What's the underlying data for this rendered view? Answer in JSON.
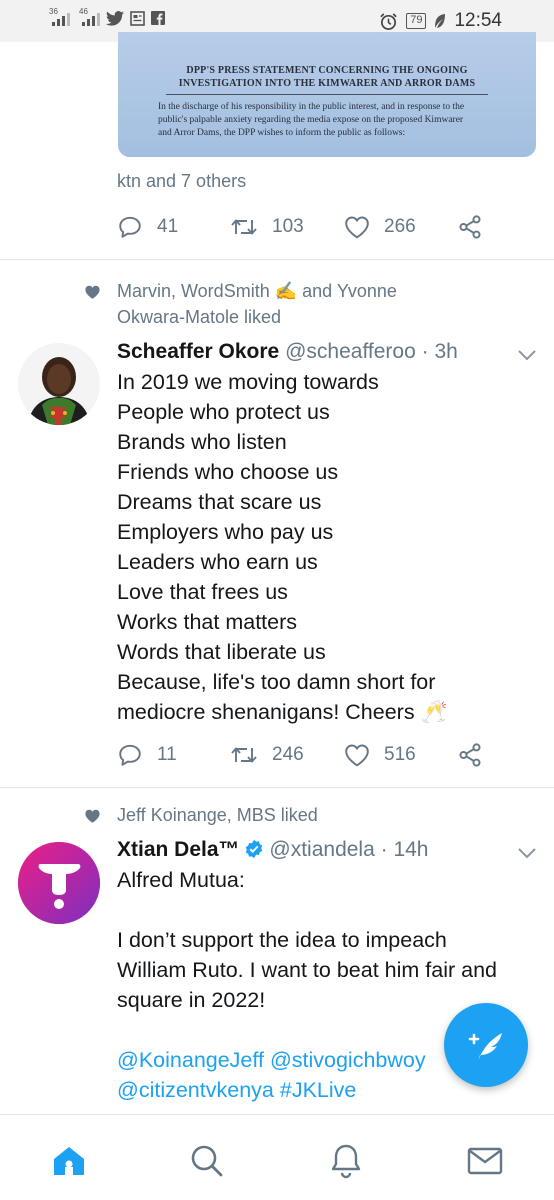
{
  "status_bar": {
    "network_1": "36",
    "network_2": "46",
    "battery": "79",
    "time": "12:54"
  },
  "tweet1": {
    "document": {
      "heading_line1": "DPP'S PRESS STATEMENT CONCERNING THE ONGOING",
      "heading_line2": "INVESTIGATION INTO THE KIMWARER AND ARROR DAMS",
      "body_line1": "In the discharge of his responsibility in the public interest, and in response to the",
      "body_line2": "public's palpable anxiety regarding the media expose on the proposed Kimwarer",
      "body_line3": "and Arror Dams, the DPP wishes to inform the public as follows:"
    },
    "tagged": "ktn and 7 others",
    "replies": "41",
    "retweets": "103",
    "likes": "266"
  },
  "tweet2": {
    "social_line1": "Marvin, WordSmith ✍️ and Yvonne",
    "social_line2": "Okwara-Matole liked",
    "name": "Scheaffer Okore",
    "handle": "@scheafferoo",
    "time": "· 3h",
    "lines": [
      "In 2019 we moving towards",
      "People who protect us",
      "Brands who listen",
      "Friends who choose us",
      "Dreams that scare us",
      "Employers who pay us",
      "Leaders who earn us",
      "Love that frees us",
      "Works that matters",
      "Words that liberate us",
      "Because, life's too damn short for",
      "mediocre shenanigans! Cheers 🥂"
    ],
    "replies": "11",
    "retweets": "246",
    "likes": "516"
  },
  "tweet3": {
    "social_line1": "Jeff Koinange, MBS liked",
    "name": "Xtian Dela™",
    "handle": "@xtiandela",
    "time": "· 14h",
    "line1": "Alfred Mutua:",
    "line2": "I don’t support the idea to impeach",
    "line3": "William Ruto. I want to beat him fair and",
    "line4": "square in 2022!",
    "mention1": "@KoinangeJeff",
    "mention2": "@stivogichbwoy",
    "mention3": "@citizentvkenya",
    "hashtag": "#JKLive"
  },
  "colors": {
    "accent": "#1da1f2",
    "muted": "#657786",
    "text": "#14171a"
  },
  "icons": {
    "reply": "reply-icon",
    "retweet": "retweet-icon",
    "like": "heart-icon",
    "share": "share-icon",
    "compose": "compose-tweet-icon",
    "home": "home-icon",
    "search": "search-icon",
    "notifications": "bell-icon",
    "messages": "mail-icon"
  }
}
